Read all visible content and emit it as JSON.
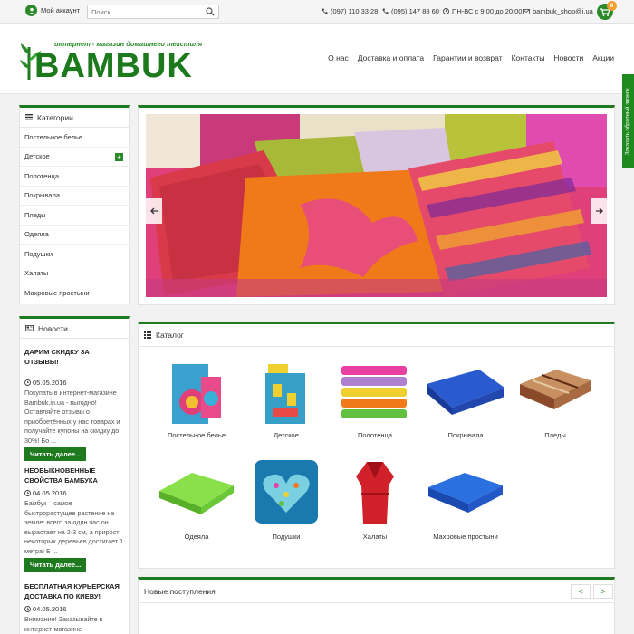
{
  "topbar": {
    "account_label": "Мой аккаунт",
    "search_placeholder": "Поиск",
    "phone1": "(097) 110 33 28",
    "phone2": "(095) 147 88 60",
    "hours": "ПН-ВС с 9:00 до 20:00",
    "email": "bambuk_shop@i.ua",
    "cart_count": "0"
  },
  "header": {
    "logo_tagline": "интернет - магазин домашнего текстиля",
    "logo_word": "BAMBUK",
    "nav": [
      "О нас",
      "Доставка и оплата",
      "Гарантии и возврат",
      "Контакты",
      "Новости",
      "Акции"
    ]
  },
  "feedback_tab": "Заказать обратный звонок",
  "categories": {
    "title": "Категории",
    "items": [
      "Постельное белье",
      "Детское",
      "Полотенца",
      "Покрывала",
      "Пледы",
      "Одеяла",
      "Подушки",
      "Халаты",
      "Махровые простыни"
    ]
  },
  "news": {
    "title": "Новости",
    "more_label": "Читать далее...",
    "items": [
      {
        "title": "ДАРИМ СКИДКУ ЗА ОТЗЫВЫ!",
        "date": "05.05.2016",
        "text": "Покупать в интернет-магазине Bambuk.in.ua - выгодно! Оставляйте отзывы о приобретённых у нас товарах и получайте купоны на скидку до 30%! Бо ..."
      },
      {
        "title": "НЕОБЫКНОВЕННЫЕ СВОЙСТВА БАМБУКА",
        "date": "04.05.2016",
        "text": "Бамбук – самое быстрорастущее растение на земле: всего за один час он вырастает на 2-3 см, а прирост некоторых деревьев достигает 1 метра! Б ..."
      },
      {
        "title": "БЕСПЛАТНАЯ КУРЬЕРСКАЯ ДОСТАВКА ПО КИЕВУ!",
        "date": "04.05.2016",
        "text": "Внимание! Заказывайте в интернет-магазине"
      }
    ]
  },
  "catalog": {
    "title": "Каталог",
    "items": [
      "Постельное белье",
      "Детское",
      "Полотенца",
      "Покрывала",
      "Пледы",
      "Одеяла",
      "Подушки",
      "Халаты",
      "Махровые простыни"
    ]
  },
  "new_arrivals": {
    "title": "Новые поступления",
    "prev": "<",
    "next": ">"
  },
  "colors": {
    "brand_green": "#1f7a1f",
    "accent_orange": "#f0a030"
  }
}
